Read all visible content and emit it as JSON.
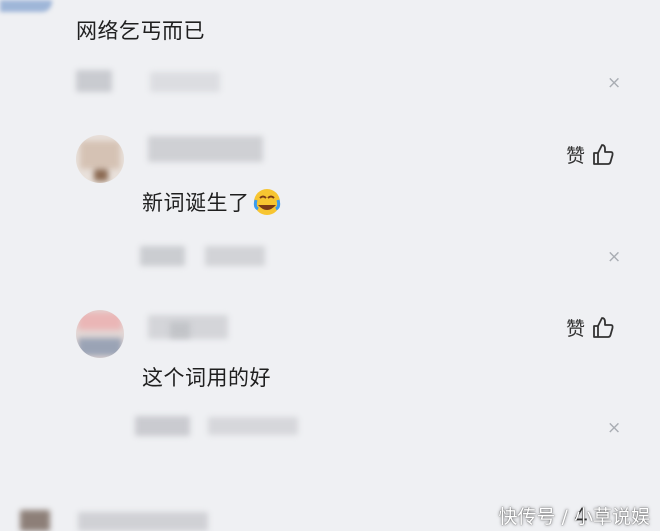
{
  "comments": [
    {
      "text": "网络乞丐而已"
    },
    {
      "text": "新词诞生了",
      "like_label": "赞",
      "emoji": "crying-laughing-emoji-icon"
    },
    {
      "text": "这个词用的好",
      "like_label": "赞"
    }
  ],
  "partial": {
    "count": "4"
  },
  "watermark": "快传号 / 小草说娱",
  "icons": {
    "close": "×",
    "thumb": "thumbs-up-icon"
  }
}
